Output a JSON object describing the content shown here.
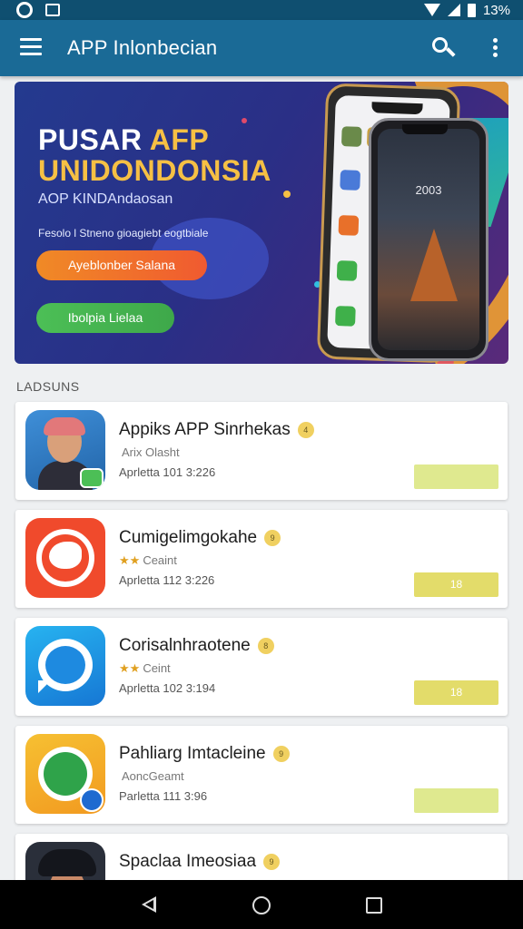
{
  "status_bar": {
    "battery_text": "13%"
  },
  "app_bar": {
    "title": "APP Inlonbecian"
  },
  "banner": {
    "title_line1_white": "PUSAR ",
    "title_line1_accent": "AFP",
    "title_line2": "UNIDONDONSIA",
    "subtitle": "AOP KINDAndaosan",
    "description": "Fesolo l Stneno gioagiebt eogtbiale",
    "primary_button": "Ayeblonber Salana",
    "secondary_button": "Ibolpia Lielaa",
    "phone_clock": "2003"
  },
  "section": {
    "label": "LADSUNS"
  },
  "apps": [
    {
      "name": "Appiks APP Sinrhekas",
      "badge": "4",
      "stars": "",
      "meta": "Arix Olasht",
      "date": "Aprletta 101 3:226",
      "action": ""
    },
    {
      "name": "Cumigelimgokahe",
      "badge": "9",
      "stars": "★★",
      "meta": "Ceaint",
      "date": "Aprletta 112 3:226",
      "action": "18"
    },
    {
      "name": "Corisalnhraotene",
      "badge": "8",
      "stars": "★★",
      "meta": "Ceint",
      "date": "Aprletta 102 3:194",
      "action": "18"
    },
    {
      "name": "Pahliarg Imtacleine",
      "badge": "9",
      "stars": "",
      "meta": "AoncGeamt",
      "date": "Parletta 111 3:96",
      "action": ""
    },
    {
      "name": "Spaclaa Imeosiaa",
      "badge": "9",
      "stars": "",
      "meta": "",
      "date": "",
      "action": ""
    }
  ]
}
